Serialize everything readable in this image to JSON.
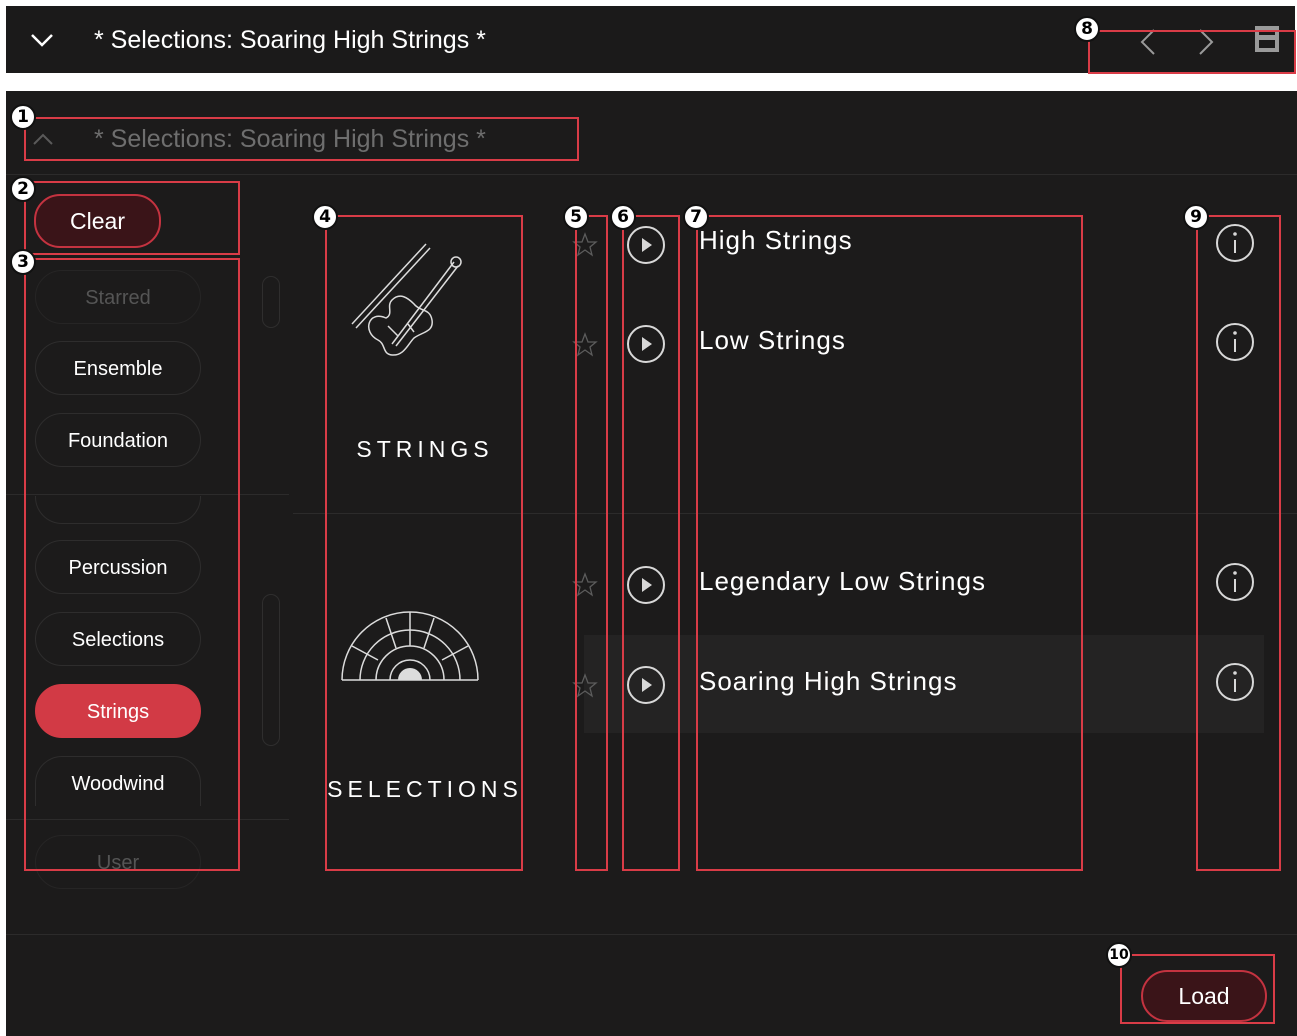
{
  "header": {
    "title": "* Selections: Soaring High Strings *"
  },
  "panel": {
    "title": "* Selections: Soaring High Strings *"
  },
  "clear_label": "Clear",
  "filters": [
    {
      "label": "Starred",
      "state": "disabled"
    },
    {
      "label": "Ensemble",
      "state": "normal"
    },
    {
      "label": "Foundation",
      "state": "normal"
    },
    {
      "label": "Percussion",
      "state": "normal"
    },
    {
      "label": "Selections",
      "state": "normal"
    },
    {
      "label": "Strings",
      "state": "active"
    },
    {
      "label": "Woodwind",
      "state": "normal"
    },
    {
      "label": "User",
      "state": "disabled"
    }
  ],
  "categories": [
    {
      "label": "STRINGS",
      "icon": "violin-icon"
    },
    {
      "label": "SELECTIONS",
      "icon": "orchestra-layout-icon"
    }
  ],
  "presets": [
    {
      "name": "High Strings"
    },
    {
      "name": "Low Strings"
    },
    {
      "name": "Legendary Low Strings"
    },
    {
      "name": "Soaring High Strings",
      "selected": true
    }
  ],
  "load_label": "Load",
  "badges": [
    "1",
    "2",
    "3",
    "4",
    "5",
    "6",
    "7",
    "8",
    "9",
    "10"
  ],
  "colors": {
    "accent": "#d23a45",
    "background": "#1c1b1b",
    "annotation": "#d93c47"
  }
}
